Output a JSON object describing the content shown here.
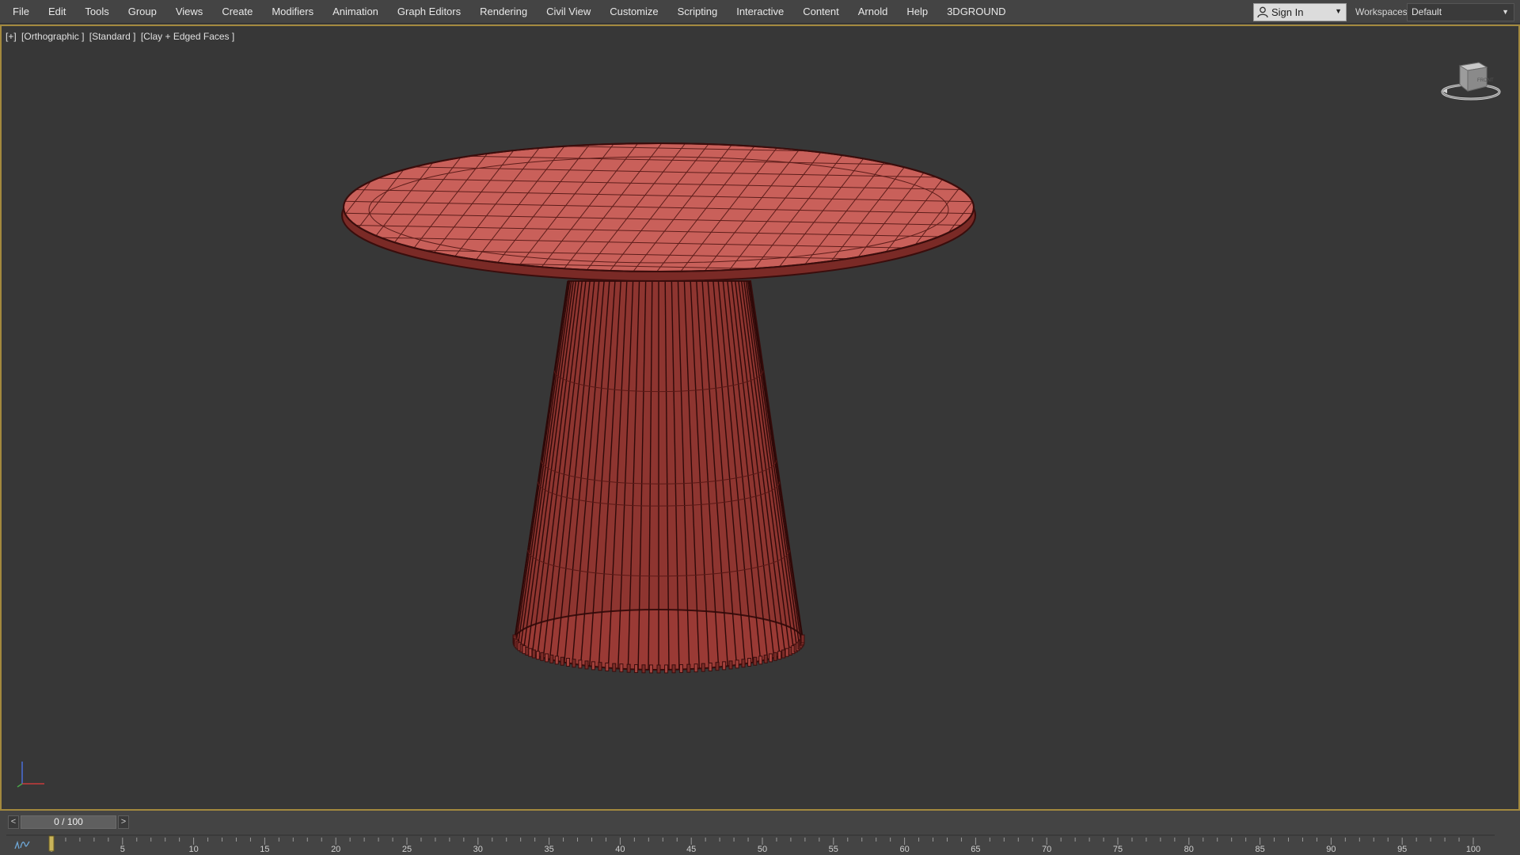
{
  "menu": {
    "items": [
      "File",
      "Edit",
      "Tools",
      "Group",
      "Views",
      "Create",
      "Modifiers",
      "Animation",
      "Graph Editors",
      "Rendering",
      "Civil View",
      "Customize",
      "Scripting",
      "Interactive",
      "Content",
      "Arnold",
      "Help",
      "3DGROUND"
    ]
  },
  "account": {
    "signin_label": "Sign In",
    "workspaces_label": "Workspaces:",
    "workspace_value": "Default"
  },
  "viewport": {
    "labels": [
      "[+]",
      "[Orthographic ]",
      "[Standard ]",
      "[Clay + Edged Faces ]"
    ],
    "viewcube_face": "FRONT",
    "model_colors": {
      "surface": "#c9605a",
      "edge": "#3a0d0c",
      "dark": "#8e3530"
    }
  },
  "timeline": {
    "prev_label": "<",
    "next_label": ">",
    "slider_text": "0 / 100",
    "current_frame": 0,
    "total_frames": 100,
    "ticks": [
      "0",
      "5",
      "10",
      "15",
      "20",
      "25",
      "30",
      "35",
      "40",
      "45",
      "50",
      "55",
      "60",
      "65",
      "70",
      "75",
      "80",
      "85",
      "90",
      "95",
      "100"
    ],
    "curve_icon": "curve-editor-icon"
  },
  "colors": {
    "viewport_border": "#a3893e",
    "background": "#373737",
    "ui": "#444444"
  }
}
